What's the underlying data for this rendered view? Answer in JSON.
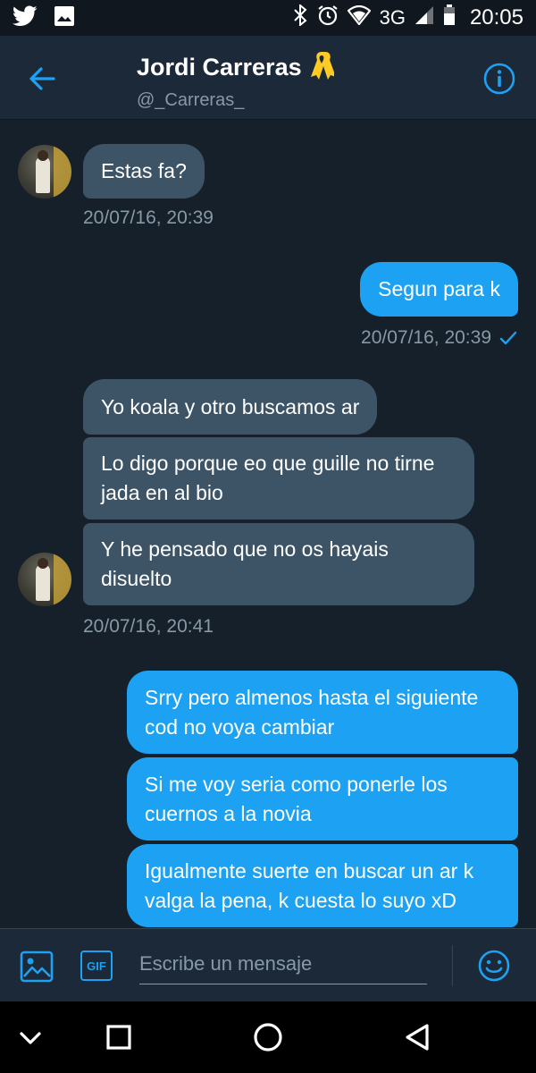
{
  "status_bar": {
    "network": "3G",
    "time": "20:05",
    "icons": [
      "twitter-icon",
      "image-icon",
      "bluetooth-icon",
      "alarm-icon",
      "wifi-icon",
      "signal-icon",
      "battery-icon"
    ]
  },
  "header": {
    "name": "Jordi Carreras",
    "emoji": "🎗️",
    "handle": "@_Carreras_",
    "icons": [
      "back-arrow-icon",
      "info-icon"
    ]
  },
  "messages": [
    {
      "dir": "in",
      "text": "Estas fa?"
    },
    {
      "dir": "out",
      "text": "Segun para k"
    },
    {
      "dir": "in",
      "text": "Yo koala y otro buscamos ar"
    },
    {
      "dir": "in",
      "text": "Lo digo porque eo que guille no tirne jada en al bio"
    },
    {
      "dir": "in",
      "text": "Y he pensado que no os hayais disuelto"
    },
    {
      "dir": "out",
      "text": "Srry pero almenos hasta el siguiente cod no voya cambiar"
    },
    {
      "dir": "out",
      "text": "Si me voy seria como ponerle los cuernos a la novia"
    },
    {
      "dir": "out",
      "text": "Igualmente suerte en buscar un ar k valga la pena,  k cuesta lo suyo xD"
    }
  ],
  "timestamps": [
    "20/07/16, 20:39",
    "20/07/16, 20:39",
    "20/07/16, 20:41"
  ],
  "composer": {
    "gif_label": "GIF",
    "placeholder": "Escribe un mensaje",
    "icons": [
      "photo-icon",
      "gif-icon",
      "emoji-icon"
    ]
  },
  "nav_bar": {
    "icons": [
      "collapse-icon",
      "recents-icon",
      "home-icon",
      "back-icon"
    ]
  },
  "colors": {
    "background": "#15202b",
    "header": "#1c2938",
    "incoming_bubble": "#3d5466",
    "outgoing_bubble": "#1da1f2",
    "accent": "#1da1f2",
    "muted_text": "#8899a6"
  }
}
